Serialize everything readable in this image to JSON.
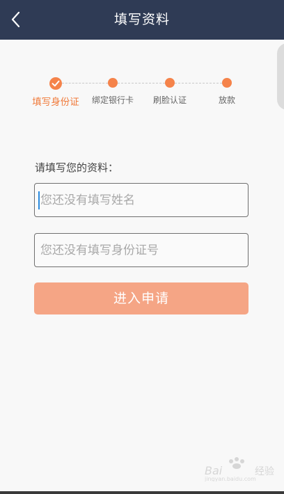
{
  "header": {
    "title": "填写资料",
    "back_icon": "chevron-left-icon",
    "background": "#2f3b55"
  },
  "steps": [
    {
      "label": "填写身份证",
      "status": "completed"
    },
    {
      "label": "绑定银行卡",
      "status": "pending"
    },
    {
      "label": "刷脸认证",
      "status": "pending"
    },
    {
      "label": "放款",
      "status": "pending"
    }
  ],
  "form": {
    "section_label": "请填写您的资料：",
    "name_placeholder": "您还没有填写姓名",
    "id_placeholder": "您还没有填写身份证号",
    "submit_label": "进入申请"
  },
  "colors": {
    "accent": "#f5834a",
    "button": "#f5a585"
  }
}
